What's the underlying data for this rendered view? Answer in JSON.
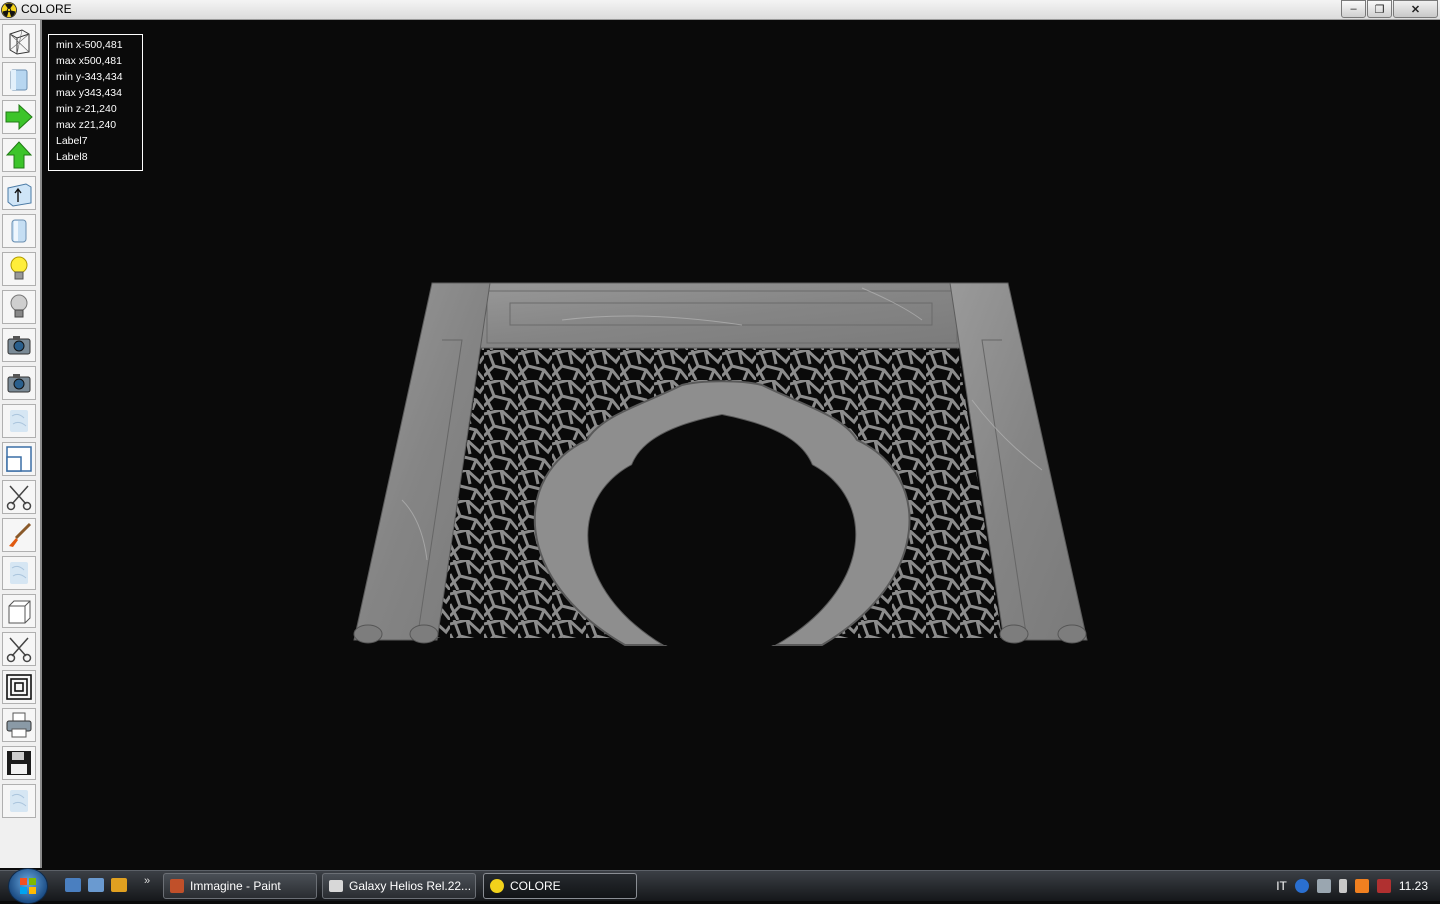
{
  "window": {
    "title": "COLORE"
  },
  "window_buttons": {
    "minimize": "‒",
    "maximize": "❐",
    "close": "✕"
  },
  "info": {
    "lines": [
      "min x-500,481",
      "max x500,481",
      "min y-343,434",
      "max y343,434",
      "min z-21,240",
      "max z21,240",
      "Label7",
      "Label8"
    ]
  },
  "toolbar": {
    "icons": [
      "wireframe-icon",
      "solid-box-icon",
      "arrow-right-icon",
      "arrow-up-icon",
      "box-arrow-up-icon",
      "cylinder-icon",
      "lightbulb-on-icon",
      "lightbulb-off-icon",
      "camera-icon",
      "camera-icon",
      "texture-icon",
      "window-resize-icon",
      "scissors-icon",
      "paintbrush-icon",
      "texture-icon",
      "cube-icon",
      "scissors-icon",
      "concentric-squares-icon",
      "printer-icon",
      "floppy-disk-icon",
      "texture-icon"
    ]
  },
  "taskbar": {
    "quick_more": "»",
    "tasks": [
      {
        "label": "Immagine - Paint"
      },
      {
        "label": "Galaxy Helios  Rel.22..."
      },
      {
        "label": "COLORE"
      }
    ],
    "tray": {
      "lang": "IT",
      "clock": "11.23"
    }
  },
  "colors": {
    "background": "#0a0a0a",
    "stone": "#8a8a8a",
    "arrow_green": "#3cc42a"
  }
}
